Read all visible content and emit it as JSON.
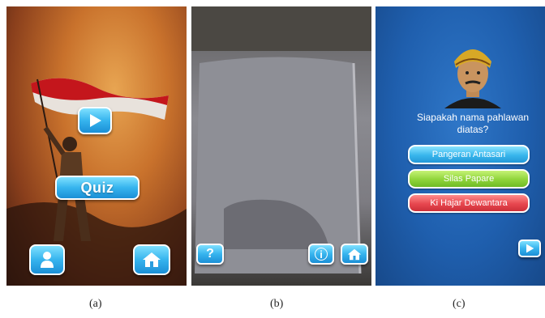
{
  "panel_a": {
    "play_icon": "play-triangle-icon",
    "quiz_label": "Quiz",
    "profile_icon": "person-icon",
    "home_icon": "home-icon"
  },
  "panel_b": {
    "help_label": "?",
    "info_label": "i",
    "home_icon": "home-icon"
  },
  "panel_c": {
    "question": "Siapakah nama pahlawan diatas?",
    "answers": [
      "Pangeran Antasari",
      "Silas Papare",
      "Ki Hajar Dewantara"
    ],
    "next_icon": "play-triangle-icon"
  },
  "captions": [
    "(a)",
    "(b)",
    "(c)"
  ],
  "colors": {
    "button_blue": "#36b4ee",
    "answer_green": "#8fd43a",
    "answer_red": "#e7474f",
    "quiz_bg": "#1f5fae"
  }
}
